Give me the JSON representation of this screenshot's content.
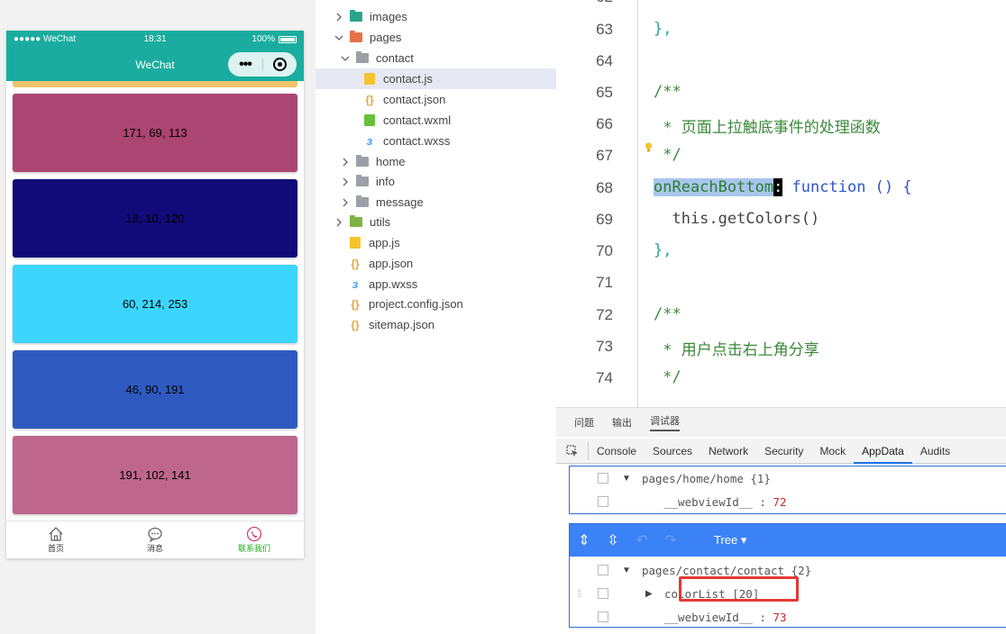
{
  "simulator": {
    "status": {
      "carrier": "●●●●● WeChat",
      "time": "18:31",
      "battery": "100%"
    },
    "nav_title": "WeChat",
    "capsule": {
      "more": "•••"
    },
    "color_blocks": [
      {
        "label": "171, 69, 113",
        "color": "#ab4571"
      },
      {
        "label": "18, 10, 120",
        "color": "#120a78"
      },
      {
        "label": "60, 214, 253",
        "color": "#3cd6fd"
      },
      {
        "label": "46, 90, 191",
        "color": "#2e5abf"
      },
      {
        "label": "191, 102, 141",
        "color": "#bf668d"
      }
    ],
    "peek_color": "#f0c36a",
    "tabs": [
      {
        "label": "首页",
        "icon": "home-icon"
      },
      {
        "label": "消息",
        "icon": "message-icon"
      },
      {
        "label": "联系我们",
        "icon": "phone-icon"
      }
    ]
  },
  "file_tree": [
    {
      "name": "images",
      "type": "folder",
      "icon": "teal-folder-icon",
      "expanded": false
    },
    {
      "name": "pages",
      "type": "folder",
      "icon": "red-folder-icon",
      "expanded": true
    },
    {
      "name": "contact",
      "type": "folder",
      "icon": "folder-icon",
      "expanded": true
    },
    {
      "name": "contact.js",
      "type": "js",
      "selected": true
    },
    {
      "name": "contact.json",
      "type": "json"
    },
    {
      "name": "contact.wxml",
      "type": "wxml"
    },
    {
      "name": "contact.wxss",
      "type": "wxss"
    },
    {
      "name": "home",
      "type": "folder",
      "icon": "folder-icon",
      "expanded": false
    },
    {
      "name": "info",
      "type": "folder",
      "icon": "folder-icon",
      "expanded": false
    },
    {
      "name": "message",
      "type": "folder",
      "icon": "folder-icon",
      "expanded": false
    },
    {
      "name": "utils",
      "type": "folder",
      "icon": "green-folder-icon",
      "expanded": false
    },
    {
      "name": "app.js",
      "type": "js"
    },
    {
      "name": "app.json",
      "type": "json"
    },
    {
      "name": "app.wxss",
      "type": "wxss"
    },
    {
      "name": "project.config.json",
      "type": "json"
    },
    {
      "name": "sitemap.json",
      "type": "json"
    }
  ],
  "editor": {
    "partial_line_number": "62",
    "lines": [
      {
        "no": "63",
        "text": "},"
      },
      {
        "no": "64",
        "text": ""
      },
      {
        "no": "65",
        "text": "/**"
      },
      {
        "no": "66",
        "text": " * 页面上拉触底事件的处理函数"
      },
      {
        "no": "67",
        "text": " */"
      },
      {
        "no": "68",
        "text": "onReachBottom: function () {"
      },
      {
        "no": "69",
        "text": "  this.getColors()"
      },
      {
        "no": "70",
        "text": "},"
      },
      {
        "no": "71",
        "text": ""
      },
      {
        "no": "72",
        "text": "/**"
      },
      {
        "no": "73",
        "text": " * 用户点击右上角分享"
      },
      {
        "no": "74",
        "text": " */"
      }
    ],
    "line68": {
      "selected": "onReachBottom",
      "colon": ":",
      "rest": " function () {"
    }
  },
  "devtools": {
    "top_tabs": [
      "问题",
      "输出",
      "调试器"
    ],
    "active_top_tab": "调试器",
    "tabs": [
      "Console",
      "Sources",
      "Network",
      "Security",
      "Mock",
      "AppData",
      "Audits"
    ],
    "active_tab": "AppData",
    "home_panel": {
      "page": "pages/home/home {1}",
      "webview_key": "__webviewId__",
      "webview_sep": " : ",
      "webview_val": "72"
    },
    "tree_mode": "Tree",
    "contact_panel": {
      "page": "pages/contact/contact {2}",
      "colorlist": "colorList [20]",
      "webview_key": "__webviewId__",
      "webview_sep": " : ",
      "webview_val": "73"
    }
  }
}
